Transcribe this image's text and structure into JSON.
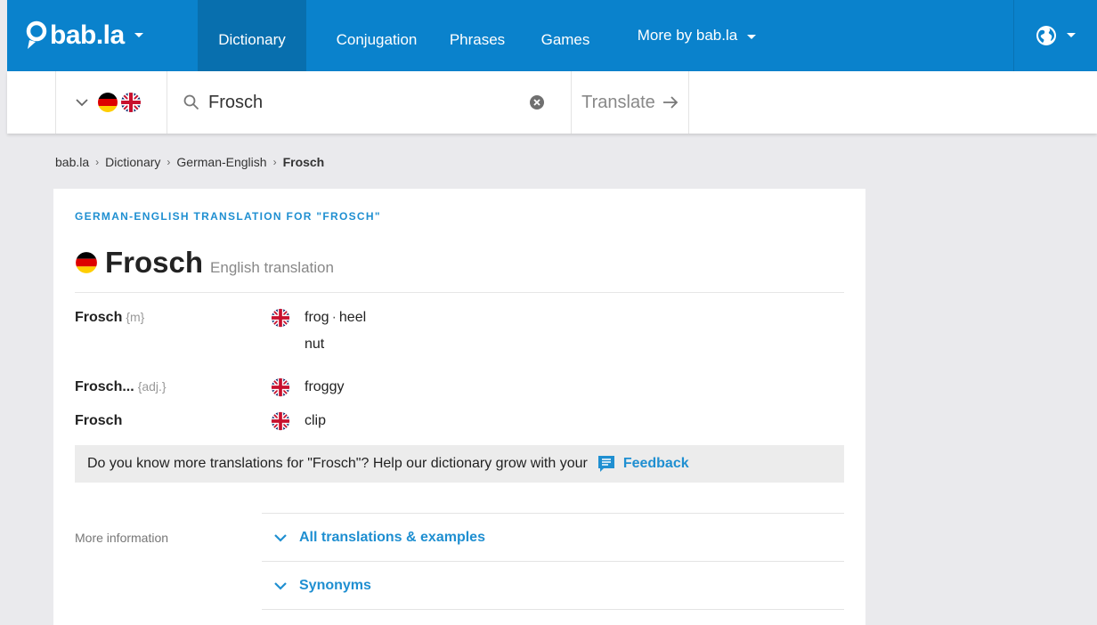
{
  "colors": {
    "brand": "#0a82cc",
    "brand_active": "#086fae",
    "link": "#1f8fd1",
    "page_bg": "#eaeaed"
  },
  "header": {
    "logo_text": "bab.la",
    "nav": [
      {
        "label": "Dictionary",
        "active": true
      },
      {
        "label": "Conjugation"
      },
      {
        "label": "Phrases"
      },
      {
        "label": "Games"
      },
      {
        "label": "More by bab.la"
      }
    ],
    "language_icon": "globe-icon"
  },
  "search": {
    "language_pair": [
      "German",
      "English"
    ],
    "value": "Frosch",
    "translate_label": "Translate"
  },
  "breadcrumb": [
    "bab.la",
    "Dictionary",
    "German-English",
    "Frosch"
  ],
  "entry": {
    "heading": "GERMAN-ENGLISH TRANSLATION FOR \"FROSCH\"",
    "word": "Frosch",
    "subtitle": "English translation",
    "rows": [
      {
        "term": "Frosch",
        "gram": "{m}",
        "words": [
          "frog",
          "heel"
        ],
        "extra": "nut"
      },
      {
        "term": "Frosch...",
        "gram": "{adj.}",
        "words": [
          "froggy"
        ]
      },
      {
        "term": "Frosch",
        "gram": "",
        "words": [
          "clip"
        ]
      }
    ],
    "feedback_text": "Do you know more translations for \"Frosch\"? Help our dictionary grow with your",
    "feedback_link": "Feedback"
  },
  "more_info": {
    "label": "More information",
    "links": [
      "All translations & examples",
      "Synonyms"
    ]
  }
}
